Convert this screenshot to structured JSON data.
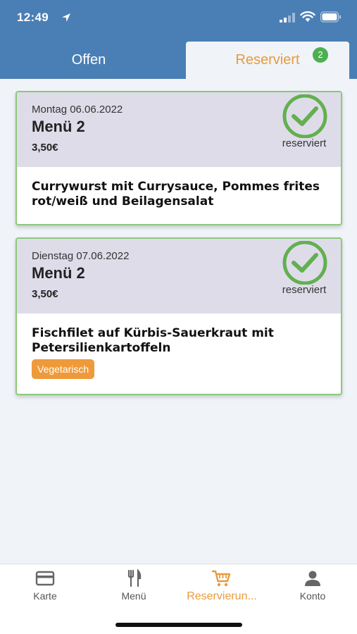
{
  "status": {
    "time": "12:49"
  },
  "tabs": {
    "open_label": "Offen",
    "reserved_label": "Reserviert",
    "reserved_count": "2"
  },
  "cards": [
    {
      "day": "Montag 06.06.2022",
      "menu": "Menü 2",
      "price": "3,50€",
      "status": "reserviert",
      "description": "Currywurst mit Currysauce, Pommes frites rot/weiß und Beilagensalat",
      "tag": ""
    },
    {
      "day": "Dienstag 07.06.2022",
      "menu": "Menü 2",
      "price": "3,50€",
      "status": "reserviert",
      "description": "Fischfilet auf Kürbis-Sauerkraut mit Petersilienkartoffeln",
      "tag": "Vegetarisch"
    }
  ],
  "bottom_nav": [
    {
      "label": "Karte",
      "icon": "card-icon"
    },
    {
      "label": "Menü",
      "icon": "cutlery-icon"
    },
    {
      "label": "Reservierun...",
      "icon": "cart-icon",
      "active": true
    },
    {
      "label": "Konto",
      "icon": "person-icon"
    }
  ],
  "colors": {
    "header": "#4a7fb5",
    "accent": "#e89a3c",
    "success": "#4caf50",
    "card_border": "#8cc97c",
    "card_head": "#dfdcea"
  }
}
